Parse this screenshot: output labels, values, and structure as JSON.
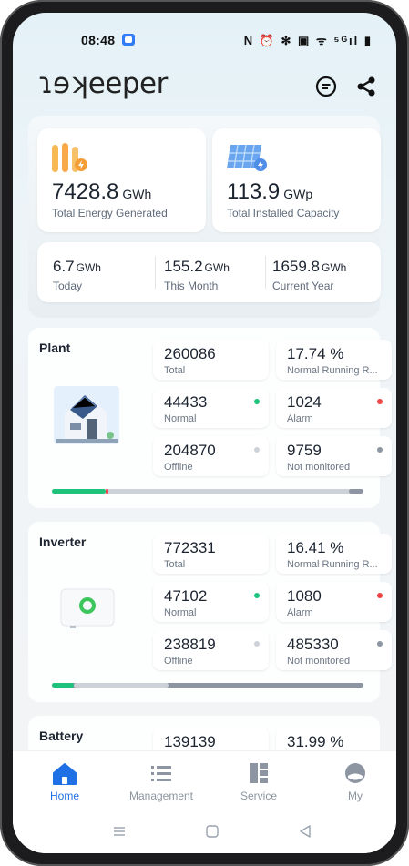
{
  "status_bar": {
    "time": "08:48",
    "icons_text": "N ⏰ ✻ ▣ ᯤ ⁵ᴳıl ▮"
  },
  "app": {
    "logo": "ɿɘʞeeper"
  },
  "header": {
    "message_icon": "message-icon",
    "share_icon": "share-icon"
  },
  "summary": {
    "energy": {
      "value": "7428.8",
      "unit": "GWh",
      "label": "Total Energy Generated"
    },
    "capacity": {
      "value": "113.9",
      "unit": "GWp",
      "label": "Total Installed Capacity"
    },
    "today": {
      "value": "6.7",
      "unit": "GWh",
      "label": "Today"
    },
    "month": {
      "value": "155.2",
      "unit": "GWh",
      "label": "This Month"
    },
    "year": {
      "value": "1659.8",
      "unit": "GWh",
      "label": "Current Year"
    }
  },
  "plant": {
    "title": "Plant",
    "total": {
      "value": "260086",
      "label": "Total"
    },
    "running": {
      "value": "17.74 %",
      "label": "Normal Running R..."
    },
    "normal": {
      "value": "44433",
      "label": "Normal"
    },
    "alarm": {
      "value": "1024",
      "label": "Alarm"
    },
    "offline": {
      "value": "204870",
      "label": "Offline"
    },
    "not_monitored": {
      "value": "9759",
      "label": "Not monitored"
    }
  },
  "inverter": {
    "title": "Inverter",
    "total": {
      "value": "772331",
      "label": "Total"
    },
    "running": {
      "value": "16.41 %",
      "label": "Normal Running R..."
    },
    "normal": {
      "value": "47102",
      "label": "Normal"
    },
    "alarm": {
      "value": "1080",
      "label": "Alarm"
    },
    "offline": {
      "value": "238819",
      "label": "Offline"
    },
    "not_monitored": {
      "value": "485330",
      "label": "Not monitored"
    }
  },
  "battery": {
    "title": "Battery",
    "total": {
      "value": "139139"
    },
    "running": {
      "value": "31.99 %"
    }
  },
  "nav": {
    "home": "Home",
    "management": "Management",
    "service": "Service",
    "my": "My"
  },
  "colors": {
    "accent": "#1f6fe5",
    "normal": "#1fc27a",
    "alarm": "#ef4444",
    "offline": "#cdd2d8",
    "not_monitored": "#8c95a1"
  }
}
